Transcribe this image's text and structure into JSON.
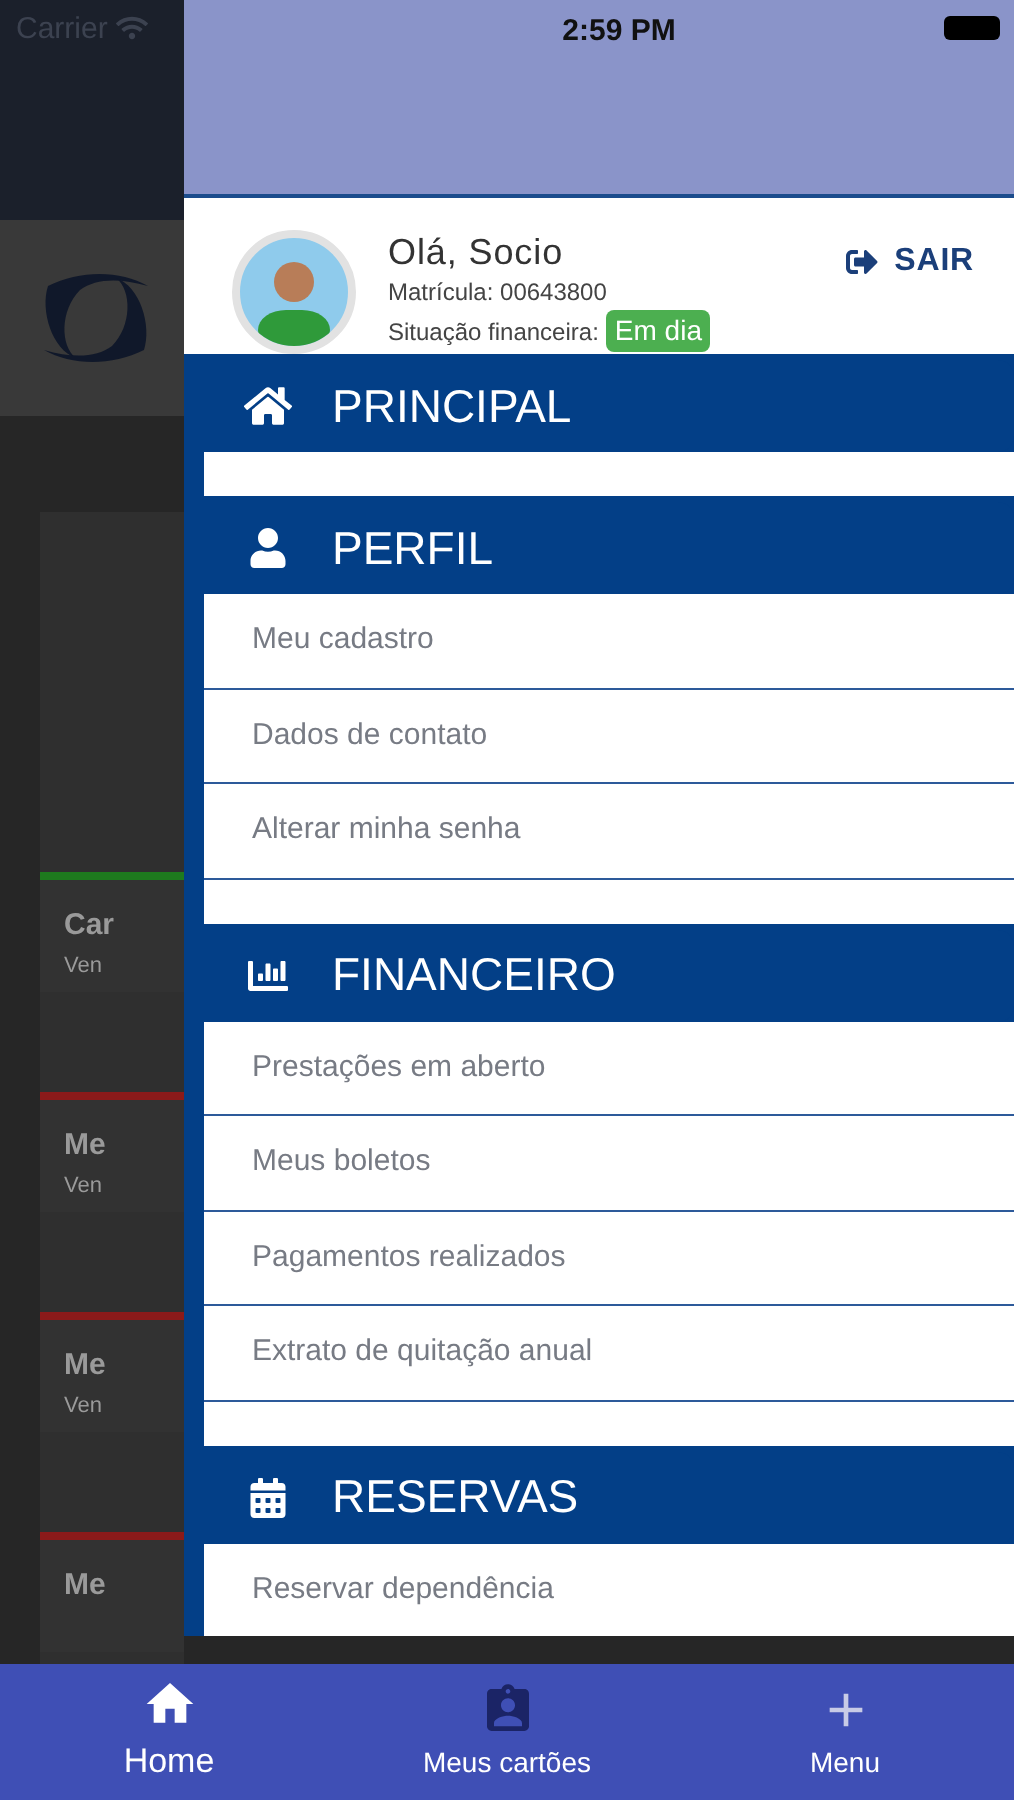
{
  "status_bar": {
    "carrier": "Carrier",
    "time": "2:59 PM"
  },
  "background": {
    "cards": [
      {
        "title": "Car",
        "subtitle": "Ven",
        "color": "#1e7a1e"
      },
      {
        "title": "Me",
        "subtitle": "Ven",
        "color": "#8b1a1a"
      },
      {
        "title": "Me",
        "subtitle": "Ven",
        "color": "#8b1a1a"
      },
      {
        "title": "Me",
        "color": "#8b1a1a"
      }
    ]
  },
  "drawer": {
    "profile": {
      "greeting": "Olá, Socio",
      "registration": "Matrícula: 00643800",
      "status_label": "Situação financeira:",
      "status_badge": "Em dia",
      "logout": "SAIR"
    },
    "sections": [
      {
        "title": "PRINCIPAL",
        "kind": "home"
      },
      {
        "title": "PERFIL",
        "kind": "user",
        "items": [
          "Meu cadastro",
          "Dados de contato",
          "Alterar minha senha"
        ]
      },
      {
        "title": "FINANCEIRO",
        "kind": "chart",
        "items": [
          "Prestações em aberto",
          "Meus boletos",
          "Pagamentos realizados",
          "Extrato de quitação anual"
        ]
      },
      {
        "title": "RESERVAS",
        "kind": "calendar",
        "items": [
          "Reservar dependência"
        ]
      }
    ]
  },
  "bottom_nav": [
    {
      "label": "Home",
      "kind": "home",
      "selected": true
    },
    {
      "label": "Meus cartões",
      "kind": "card",
      "selected": false
    },
    {
      "label": "Menu",
      "kind": "plus",
      "selected": false
    }
  ]
}
